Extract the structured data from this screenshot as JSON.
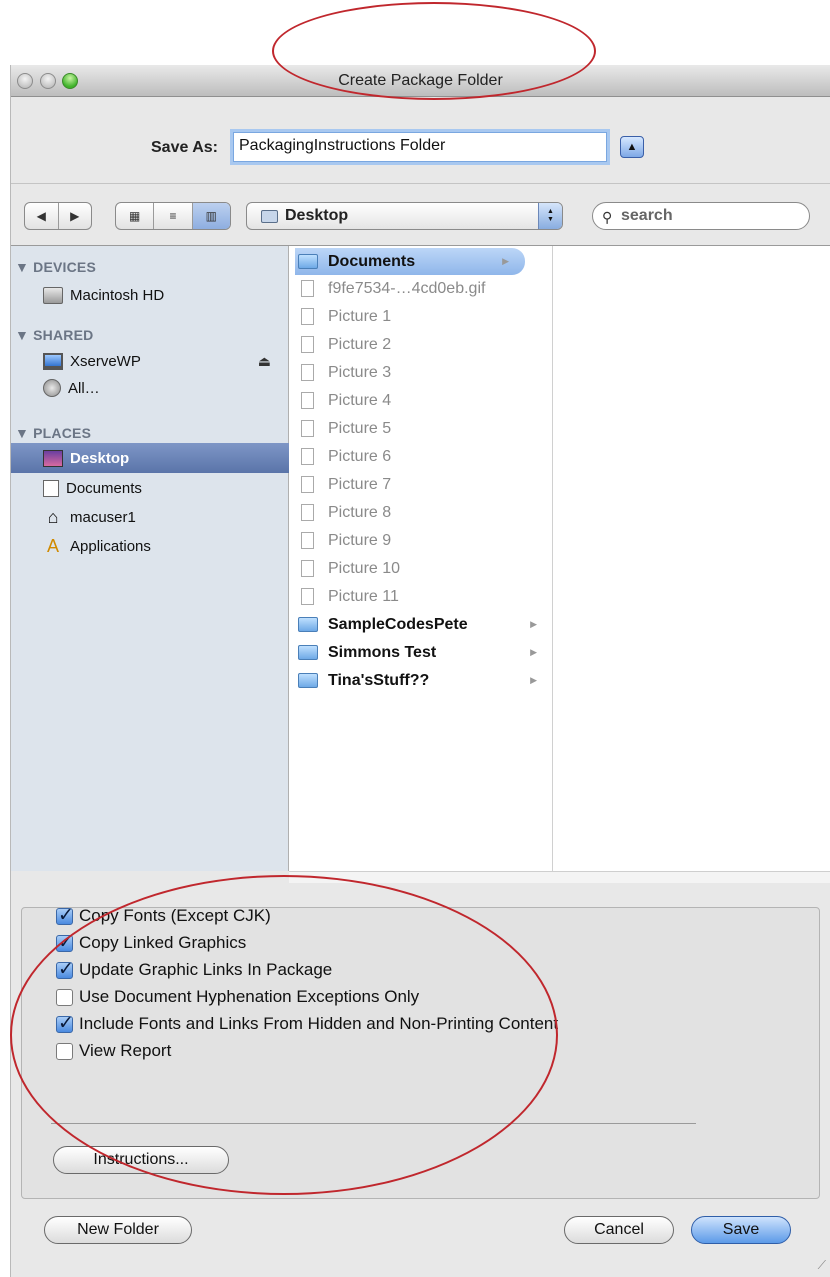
{
  "window": {
    "title": "Create Package Folder"
  },
  "save_as": {
    "label": "Save As:",
    "value": "PackagingInstructions Folder"
  },
  "toolbar": {
    "location": "Desktop",
    "search_placeholder": "search"
  },
  "sidebar": {
    "devices_header": "▼ DEVICES",
    "devices": [
      {
        "label": "Macintosh HD"
      }
    ],
    "shared_header": "▼ SHARED",
    "shared": [
      {
        "label": "XserveWP"
      },
      {
        "label": "All…"
      }
    ],
    "places_header": "▼ PLACES",
    "places": [
      {
        "label": "Desktop",
        "selected": true
      },
      {
        "label": "Documents"
      },
      {
        "label": "macuser1"
      },
      {
        "label": "Applications"
      }
    ]
  },
  "files": [
    {
      "name": "Documents",
      "kind": "folder",
      "selected": true
    },
    {
      "name": "f9fe7534-…4cd0eb.gif",
      "kind": "file"
    },
    {
      "name": "Picture 1",
      "kind": "file"
    },
    {
      "name": "Picture 2",
      "kind": "file"
    },
    {
      "name": "Picture 3",
      "kind": "file"
    },
    {
      "name": "Picture 4",
      "kind": "file"
    },
    {
      "name": "Picture 5",
      "kind": "file"
    },
    {
      "name": "Picture 6",
      "kind": "file"
    },
    {
      "name": "Picture 7",
      "kind": "file"
    },
    {
      "name": "Picture 8",
      "kind": "file"
    },
    {
      "name": "Picture 9",
      "kind": "file"
    },
    {
      "name": "Picture 10",
      "kind": "file"
    },
    {
      "name": "Picture 11",
      "kind": "file"
    },
    {
      "name": "SampleCodesPete",
      "kind": "folder"
    },
    {
      "name": "Simmons Test",
      "kind": "folder"
    },
    {
      "name": "Tina'sStuff??",
      "kind": "folder"
    }
  ],
  "options": [
    {
      "label": "Copy Fonts (Except CJK)",
      "checked": true
    },
    {
      "label": "Copy Linked Graphics",
      "checked": true
    },
    {
      "label": "Update Graphic Links In Package",
      "checked": true
    },
    {
      "label": "Use Document Hyphenation Exceptions Only",
      "checked": false
    },
    {
      "label": "Include Fonts and Links From Hidden and Non-Printing Content",
      "checked": true
    },
    {
      "label": "View Report",
      "checked": false
    }
  ],
  "buttons": {
    "instructions": "Instructions...",
    "new_folder": "New Folder",
    "cancel": "Cancel",
    "save": "Save"
  },
  "colors": {
    "selection": "#5a74a9",
    "accent": "#5c9ae8",
    "annotation": "#c0272d"
  }
}
